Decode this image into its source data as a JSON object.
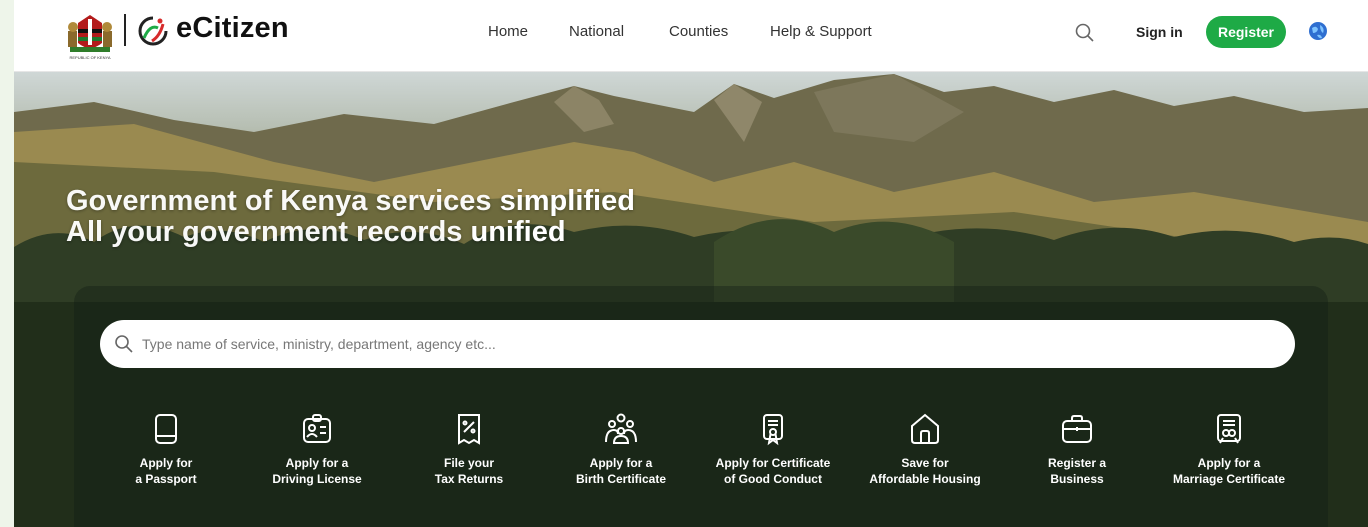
{
  "brand": {
    "name": "eCitizen",
    "coat_caption": "REPUBLIC OF KENYA"
  },
  "nav": [
    {
      "label": "Home"
    },
    {
      "label": "National"
    },
    {
      "label": "Counties"
    },
    {
      "label": "Help & Support"
    }
  ],
  "header": {
    "signin_label": "Sign in",
    "register_label": "Register"
  },
  "hero": {
    "line1_light": "Government of Kenya services ",
    "line1_strong": "simplified",
    "line2_light": "All your government records ",
    "line2_strong": "unified"
  },
  "search": {
    "placeholder": "Type name of service, ministry, department, agency etc..."
  },
  "services": [
    {
      "line1": "Apply for",
      "line2": "a Passport",
      "icon": "passport-icon"
    },
    {
      "line1": "Apply for a",
      "line2": "Driving License",
      "icon": "id-card-icon"
    },
    {
      "line1": "File your",
      "line2": "Tax Returns",
      "icon": "tax-receipt-icon"
    },
    {
      "line1": "Apply for a",
      "line2": "Birth Certificate",
      "icon": "family-icon"
    },
    {
      "line1": "Apply for Certificate",
      "line2": "of Good Conduct",
      "icon": "certificate-icon"
    },
    {
      "line1": "Save for",
      "line2": "Affordable Housing",
      "icon": "house-icon"
    },
    {
      "line1": "Register a",
      "line2": "Business",
      "icon": "briefcase-icon"
    },
    {
      "line1": "Apply for a",
      "line2": "Marriage Certificate",
      "icon": "marriage-certificate-icon"
    }
  ],
  "colors": {
    "accent": "#1eaa46",
    "text": "#111111"
  }
}
